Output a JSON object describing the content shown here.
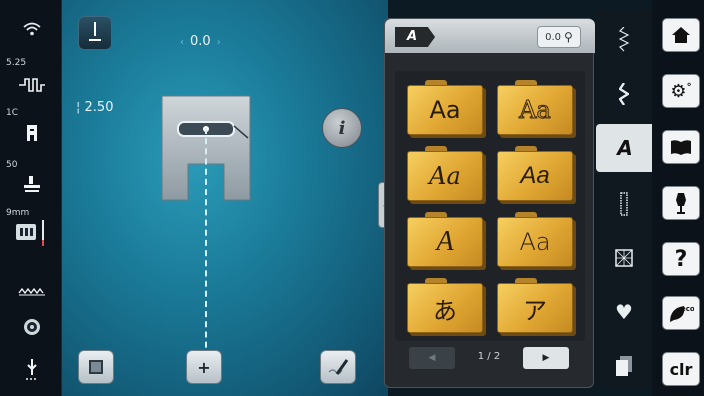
{
  "status_bar": {
    "stitch_length": "5.25",
    "foot_number": "1C",
    "tension": "50",
    "needle_size": "9mm"
  },
  "sewing_area": {
    "needle_position": "0.0",
    "stitch_width": "2.50",
    "info_label": "i"
  },
  "font_panel": {
    "selected_font_tag": "A",
    "zoom_label": "0.0",
    "fonts": [
      {
        "sample": "Aa",
        "name": "block"
      },
      {
        "sample": "Aa",
        "name": "outline"
      },
      {
        "sample": "Aa",
        "name": "script"
      },
      {
        "sample": "Aa",
        "name": "italic-sans"
      },
      {
        "sample": "A",
        "name": "calligraphy"
      },
      {
        "sample": "Aa",
        "name": "rounded"
      },
      {
        "sample": "あ",
        "name": "hiragana"
      },
      {
        "sample": "ア",
        "name": "katakana"
      }
    ],
    "page_indicator": "1 / 2"
  },
  "categories": {
    "active_label": "A"
  },
  "system_buttons": {
    "clear_label": "clr",
    "help_label": "?",
    "eco_label": "eco"
  },
  "colors": {
    "folder_gold": "#e1a733",
    "screen_teal": "#1a7a98",
    "panel_dark": "#262a2e"
  }
}
